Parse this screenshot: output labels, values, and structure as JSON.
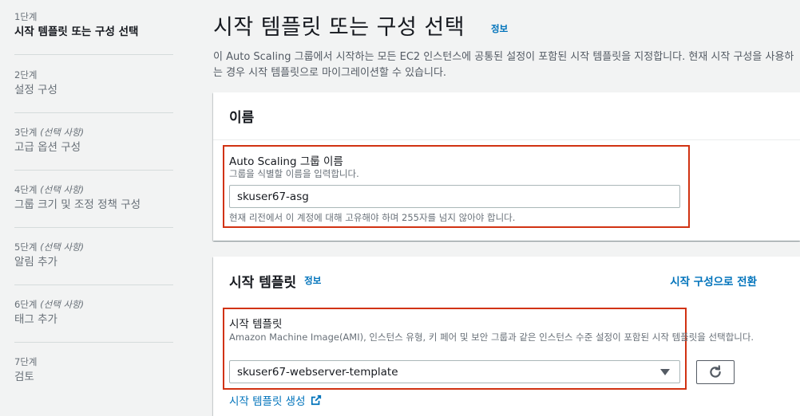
{
  "steps": [
    {
      "num": "1단계",
      "optional": "",
      "title": "시작 템플릿 또는 구성 선택"
    },
    {
      "num": "2단계",
      "optional": "",
      "title": "설정 구성"
    },
    {
      "num": "3단계",
      "optional": "(선택 사항)",
      "title": "고급 옵션 구성"
    },
    {
      "num": "4단계",
      "optional": "(선택 사항)",
      "title": "그룹 크기 및 조정 정책 구성"
    },
    {
      "num": "5단계",
      "optional": "(선택 사항)",
      "title": "알림 추가"
    },
    {
      "num": "6단계",
      "optional": "(선택 사항)",
      "title": "태그 추가"
    },
    {
      "num": "7단계",
      "optional": "",
      "title": "검토"
    }
  ],
  "header": {
    "title": "시작 템플릿 또는 구성 선택",
    "info": "정보",
    "description": "이 Auto Scaling 그룹에서 시작하는 모든 EC2 인스턴스에 공통된 설정이 포함된 시작 템플릿을 지정합니다. 현재 시작 구성을 사용하는 경우 시작 템플릿으로 마이그레이션할 수 있습니다."
  },
  "name_panel": {
    "title": "이름",
    "field_label": "Auto Scaling 그룹 이름",
    "field_desc": "그룹을 식별할 이름을 입력합니다.",
    "value": "skuser67-asg",
    "constraint": "현재 리전에서 이 계정에 대해 고유해야 하며 255자를 넘지 않아야 합니다."
  },
  "template_panel": {
    "title": "시작 템플릿",
    "info": "정보",
    "switch_link": "시작 구성으로 전환",
    "field_label": "시작 템플릿",
    "field_desc": "Amazon Machine Image(AMI), 인스턴스 유형, 키 페어 및 보안 그룹과 같은 인스턴스 수준 설정이 포함된 시작 템플릿을 선택합니다.",
    "selected": "skuser67-webserver-template",
    "create_link": "시작 템플릿 생성"
  },
  "colors": {
    "link": "#0073bb",
    "highlight_border": "#d13212"
  },
  "icons": {
    "refresh": "refresh-icon",
    "external": "external-link-icon",
    "dropdown": "caret-down-icon"
  }
}
